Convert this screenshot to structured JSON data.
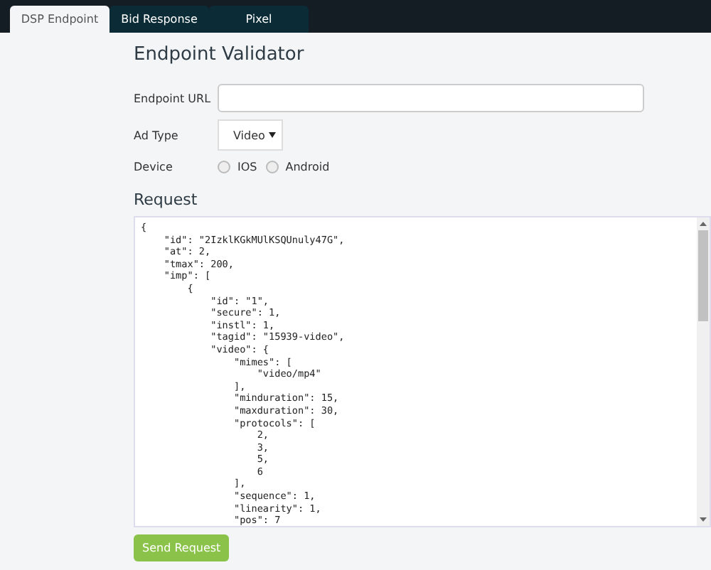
{
  "tabs": [
    {
      "label": "DSP Endpoint",
      "selected": true
    },
    {
      "label": "Bid Response",
      "selected": false
    },
    {
      "label": "Pixel",
      "selected": false
    }
  ],
  "title": "Endpoint Validator",
  "endpoint_url": {
    "label": "Endpoint URL"
  },
  "ad_type": {
    "label": "Ad Type",
    "value": "Video"
  },
  "device": {
    "label": "Device",
    "options": [
      {
        "label": "IOS",
        "selected": false
      },
      {
        "label": "Android",
        "selected": false
      }
    ]
  },
  "request": {
    "heading": "Request",
    "lines": [
      "{",
      "    \"id\": \"2IzklKGkMUlKSQUnuly47G\",",
      "    \"at\": 2,",
      "    \"tmax\": 200,",
      "    \"imp\": [",
      "        {",
      "            \"id\": \"1\",",
      "            \"secure\": 1,",
      "            \"instl\": 1,",
      "            \"tagid\": \"15939-video\",",
      "            \"video\": {",
      "                \"mimes\": [",
      "                    \"video/mp4\"",
      "                ],",
      "                \"minduration\": 15,",
      "                \"maxduration\": 30,",
      "                \"protocols\": [",
      "                    2,",
      "                    3,",
      "                    5,",
      "                    6",
      "                ],",
      "                \"sequence\": 1,",
      "                \"linearity\": 1,",
      "                \"pos\": 7"
    ]
  },
  "send_button": "Send Request"
}
